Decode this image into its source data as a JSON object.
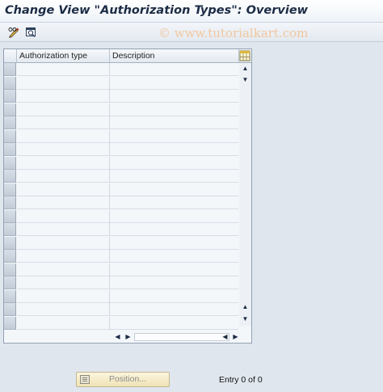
{
  "window": {
    "title": "Change View \"Authorization Types\": Overview"
  },
  "toolbar": {
    "icons": [
      "edit-toggle-icon",
      "details-icon"
    ]
  },
  "watermark": "© www.tutorialkart.com",
  "table": {
    "columns": [
      "Authorization type",
      "Description"
    ],
    "row_count_visible": 20,
    "rows": []
  },
  "footer": {
    "position_label": "Position...",
    "entry_text": "Entry 0 of 0"
  },
  "colors": {
    "title_text": "#1c2c45",
    "background": "#dfe6ee",
    "watermark": "#f1c79e",
    "position_button": "#fdf6dd"
  }
}
